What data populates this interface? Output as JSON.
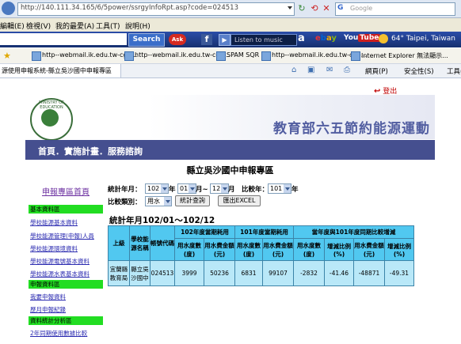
{
  "browser": {
    "url": "http://140.111.34.165/6/5power/ssrgyInfoRpt.asp?code=024513",
    "search_placeholder": "Google",
    "menu": [
      "編輯(E)",
      "檢視(V)",
      "我的最愛(A)",
      "工具(T)",
      "說明(H)"
    ],
    "toolbar": {
      "search_button": "Search",
      "ask_label": "Ask",
      "music_label": "Listen to music",
      "amazon_label": "a",
      "ebay_label": [
        "e",
        "b",
        "a",
        "y"
      ],
      "youtube_label": [
        "You",
        "Tube"
      ],
      "weather": "64° Taipei, Taiwan"
    },
    "favorites": [
      "http--webmail.ik.edu.tw-cgi-...",
      "http--webmail.ik.edu.tw-cgi-...",
      "SPAM SQR",
      "http--webmail.ik.edu.tw-cgi-...",
      "Internet Explorer 無法顯示..."
    ],
    "tab_title": "源使用申報系統-縣立吳沙國中申報專區",
    "tab_tools": [
      "網頁(P)",
      "安全性(S)",
      "工具("
    ]
  },
  "page": {
    "logout": "登出",
    "seal_text": "MINISTRY OF EDUCATION",
    "banner_title": "教育部六五節約能源運動",
    "nav": "首頁．實施計畫．服務諮詢",
    "title": "縣立吳沙國中申報專區",
    "home_link": "申報專區首頁",
    "sidebar": [
      {
        "type": "head",
        "label": "基本資料區"
      },
      {
        "type": "link",
        "label": "學校能源基本資料"
      },
      {
        "type": "link",
        "label": "學校能源管理(申報)人員"
      },
      {
        "type": "link",
        "label": "學校能源環境資料"
      },
      {
        "type": "link",
        "label": "學校能源電號基本資料"
      },
      {
        "type": "link",
        "label": "學校能源水表基本資料"
      },
      {
        "type": "head",
        "label": "申報資料區"
      },
      {
        "type": "link",
        "label": "我要申報資料"
      },
      {
        "type": "link",
        "label": "歷月申報紀錄"
      },
      {
        "type": "head",
        "label": "資料統計分析區"
      },
      {
        "type": "link",
        "label": "2年同期使用數據比較"
      }
    ],
    "form": {
      "stat_label": "統計年月：",
      "year": "102",
      "year_unit": "年",
      "month_from": "01",
      "month_sep": "月~",
      "month_to": "12",
      "month_unit": "月",
      "compare_label": "比較年：",
      "compare_year": "101",
      "compare_unit": "年",
      "type_label": "比較類別：",
      "type_value": "用水",
      "query_button": "統計查詢",
      "export_button": "匯出EXCEL"
    },
    "period": "統計年月102/01～102/12",
    "table": {
      "group_headers": [
        "102年度當期耗用",
        "101年度當期耗用",
        "當年度與101年度同期比較增減"
      ],
      "headers": [
        "上級",
        "學校能源名稱",
        "帳號代碼",
        "用水度數(度)",
        "用水費金額(元)",
        "用水度數(度)",
        "用水費金額(元)",
        "用水度數(度)",
        "增減比例(%)",
        "用水費金額(元)",
        "增減比例(%)"
      ],
      "row": [
        "宜蘭縣教育局",
        "縣立吳沙國中",
        "024513",
        "3999",
        "50236",
        "6831",
        "99107",
        "-2832",
        "-41.46",
        "-48871",
        "-49.31"
      ]
    }
  }
}
